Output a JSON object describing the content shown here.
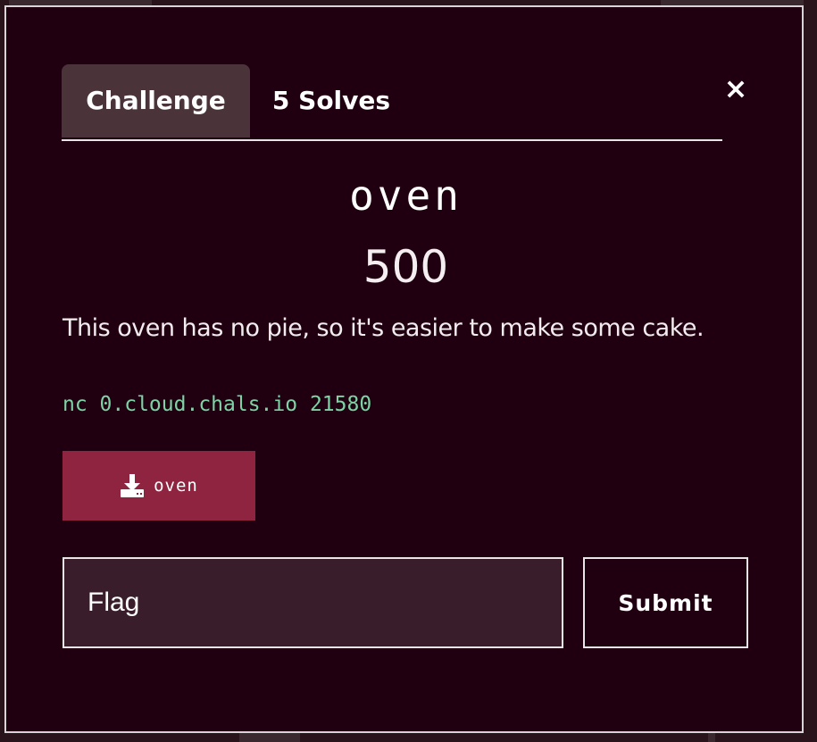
{
  "modal": {
    "tabs": [
      {
        "label": "Challenge"
      },
      {
        "label": "5 Solves"
      }
    ],
    "close_label": "×",
    "challenge": {
      "name": "oven",
      "points": "500",
      "description": "This oven has no pie, so it's easier to make some cake.",
      "connection": "nc 0.cloud.chals.io 21580",
      "download_label": "oven"
    },
    "flag_input": {
      "placeholder": "Flag",
      "value": ""
    },
    "submit_label": "Submit"
  },
  "colors": {
    "modal_bg": "#200010",
    "active_tab_bg": "#4a343a",
    "download_bg": "#8e2440",
    "code_text": "#7ed3a6",
    "input_bg": "#3a1d2a"
  },
  "icons": {
    "download": "download-icon",
    "close": "close-icon"
  }
}
